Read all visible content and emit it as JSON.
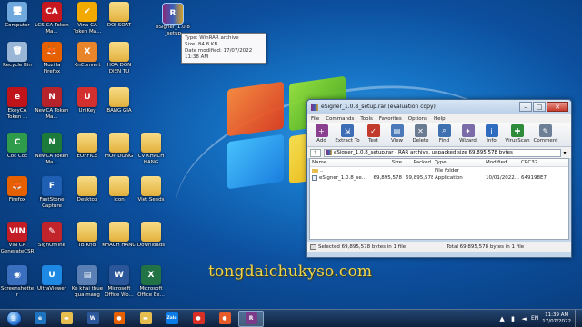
{
  "desktop": {
    "icons": [
      {
        "label": "Computer",
        "icon": "computer-icon",
        "glyph": "🖥",
        "color": "#6fa8dc"
      },
      {
        "label": "LCS-CA Token Ma...",
        "icon": "lcs-ca-icon",
        "glyph": "CA",
        "color": "#c7181f"
      },
      {
        "label": "Vina-CA Token Ma...",
        "icon": "vina-ca-icon",
        "glyph": "✔",
        "color": "#f2a900"
      },
      {
        "label": "DOI SOAT",
        "icon": "folder-icon",
        "glyph": "",
        "color": "#e6bd4f"
      },
      {
        "label": "Recycle Bin",
        "icon": "recycle-bin-icon",
        "glyph": "🗑",
        "color": "#9ab6d6"
      },
      {
        "label": "Mozilla Firefox",
        "icon": "firefox-icon",
        "glyph": "🦊",
        "color": "#e66000"
      },
      {
        "label": "XnConvert",
        "icon": "xnconvert-icon",
        "glyph": "X",
        "color": "#e8842a"
      },
      {
        "label": "HOA DON DIEN TU",
        "icon": "folder-icon",
        "glyph": "",
        "color": "#e6bd4f"
      },
      {
        "label": "EkeyCA Token ...",
        "icon": "ekeyca-icon",
        "glyph": "e",
        "color": "#c0141b"
      },
      {
        "label": "NewCA Token Ma...",
        "icon": "newca-icon",
        "glyph": "N",
        "color": "#b6232a"
      },
      {
        "label": "UniKey",
        "icon": "unikey-icon",
        "glyph": "U",
        "color": "#d32f2f"
      },
      {
        "label": "BANG GIA",
        "icon": "folder-icon",
        "glyph": "",
        "color": "#e6bd4f"
      },
      {
        "label": "Coc Coc",
        "icon": "coccoc-icon",
        "glyph": "C",
        "color": "#2e9c4a"
      },
      {
        "label": "NewCA Token Ma...",
        "icon": "newca-token-icon",
        "glyph": "N",
        "color": "#1c7a3a"
      },
      {
        "label": "EOFFICE",
        "icon": "folder-icon",
        "glyph": "",
        "color": "#e6bd4f"
      },
      {
        "label": "HOP DONG",
        "icon": "folder-icon",
        "glyph": "",
        "color": "#e6bd4f"
      },
      {
        "label": "CV KHACH HANG",
        "icon": "folder-icon",
        "glyph": "",
        "color": "#e6bd4f"
      },
      {
        "label": "Firefox",
        "icon": "firefox2-icon",
        "glyph": "🦊",
        "color": "#e66000"
      },
      {
        "label": "FastStone Capture",
        "icon": "faststone-icon",
        "glyph": "F",
        "color": "#1f5fb3"
      },
      {
        "label": "Desktop",
        "icon": "folder-icon",
        "glyph": "",
        "color": "#e6bd4f"
      },
      {
        "label": "Icon",
        "icon": "folder-icon",
        "glyph": "",
        "color": "#e6bd4f"
      },
      {
        "label": "Viet Seeds",
        "icon": "folder-icon",
        "glyph": "",
        "color": "#e6bd4f"
      },
      {
        "label": "VIN CA GenerateCSR",
        "icon": "vinca-icon",
        "glyph": "VIN",
        "color": "#c21d24"
      },
      {
        "label": "SignOffline",
        "icon": "signoffline-icon",
        "glyph": "✎",
        "color": "#c1242b"
      },
      {
        "label": "TB Khoi",
        "icon": "folder-icon",
        "glyph": "",
        "color": "#e6bd4f"
      },
      {
        "label": "KHACH HANG",
        "icon": "folder-icon",
        "glyph": "",
        "color": "#e6bd4f"
      },
      {
        "label": "Downloads",
        "icon": "folder-icon",
        "glyph": "",
        "color": "#e6bd4f"
      },
      {
        "label": "Screenshotter",
        "icon": "screenshotter-icon",
        "glyph": "◉",
        "color": "#3a6fbf"
      },
      {
        "label": "UltraViewer",
        "icon": "ultraviewer-icon",
        "glyph": "U",
        "color": "#1e88e5"
      },
      {
        "label": "Ke khai thue qua mang",
        "icon": "kekhaithue-icon",
        "glyph": "▤",
        "color": "#5a7fb5"
      },
      {
        "label": "Microsoft Office Wo...",
        "icon": "word-icon",
        "glyph": "W",
        "color": "#2b579a"
      },
      {
        "label": "Microsoft Office Ex...",
        "icon": "excel-icon",
        "glyph": "X",
        "color": "#217346"
      }
    ],
    "selected_icon": {
      "label": "eSigner_1.0.8_setup",
      "icon": "winrar-archive-icon",
      "glyph": "R",
      "color": "#7b3a8a"
    }
  },
  "tooltip": {
    "type": "Type: WinRAR archive",
    "size": "Size: 84.8 KB",
    "modified": "Date modified: 17/07/2022 11:38 AM"
  },
  "watermark": "tongdaichukyso.com",
  "winrar": {
    "title": "eSigner_1.0.8_setup.rar (evaluation copy)",
    "menu": [
      "File",
      "Commands",
      "Tools",
      "Favorites",
      "Options",
      "Help"
    ],
    "toolbar": [
      {
        "label": "Add",
        "icon": "add-icon",
        "glyph": "+",
        "color": "#8a3f8f"
      },
      {
        "label": "Extract To",
        "icon": "extract-to-icon",
        "glyph": "⇲",
        "color": "#3d6db5"
      },
      {
        "label": "Test",
        "icon": "test-icon",
        "glyph": "✓",
        "color": "#c23a2b"
      },
      {
        "label": "View",
        "icon": "view-icon",
        "glyph": "▤",
        "color": "#4a78b8"
      },
      {
        "label": "Delete",
        "icon": "delete-icon",
        "glyph": "✕",
        "color": "#6b7c92"
      },
      {
        "label": "Find",
        "icon": "find-icon",
        "glyph": "⌕",
        "color": "#3f70b0"
      },
      {
        "label": "Wizard",
        "icon": "wizard-icon",
        "glyph": "✦",
        "color": "#7a6aa8"
      },
      {
        "label": "Info",
        "icon": "info-icon",
        "glyph": "i",
        "color": "#2f6bbf"
      },
      {
        "label": "VirusScan",
        "icon": "virusscan-icon",
        "glyph": "✚",
        "color": "#2e8b3a"
      },
      {
        "label": "Comment",
        "icon": "comment-icon",
        "glyph": "✎",
        "color": "#6c7f96"
      }
    ],
    "path": "eSigner_1.0.8_setup.rar - RAR archive, unpacked size 69,895,578 bytes",
    "columns": [
      "Name",
      "Size",
      "Packed",
      "Type",
      "Modified",
      "CRC32"
    ],
    "rows": [
      {
        "name": "..",
        "size": "",
        "packed": "",
        "type": "File folder",
        "modified": "",
        "crc": "",
        "kind": "folder"
      },
      {
        "name": "eSigner_1.0.8_se...",
        "size": "69,895,578",
        "packed": "69,895,578",
        "type": "Application",
        "modified": "10/01/2022...",
        "crc": "649198E7",
        "kind": "app"
      }
    ],
    "status_left": "Selected 69,895,578 bytes in 1 file",
    "status_right": "Total 69,895,578 bytes in 1 file"
  },
  "taskbar": {
    "apps": [
      {
        "icon": "ie-icon",
        "glyph": "e",
        "color": "#1e73be"
      },
      {
        "icon": "explorer-icon",
        "glyph": "▬",
        "color": "#e6bd4f"
      },
      {
        "icon": "word-taskbar-icon",
        "glyph": "W",
        "color": "#2b579a"
      },
      {
        "icon": "firefox-taskbar-icon",
        "glyph": "●",
        "color": "#e66000"
      },
      {
        "icon": "explorer2-icon",
        "glyph": "▬",
        "color": "#e6bd4f"
      },
      {
        "icon": "zalo-icon",
        "glyph": "Zalo",
        "color": "#0b7ce6"
      },
      {
        "icon": "chrome-icon",
        "glyph": "●",
        "color": "#d93025"
      },
      {
        "icon": "chrome2-icon",
        "glyph": "●",
        "color": "#e65b2a"
      },
      {
        "icon": "winrar-taskbar-icon",
        "glyph": "R",
        "color": "#7b3a8a"
      }
    ],
    "lang": "EN",
    "time": "11:39 AM",
    "date": "17/07/2022"
  }
}
